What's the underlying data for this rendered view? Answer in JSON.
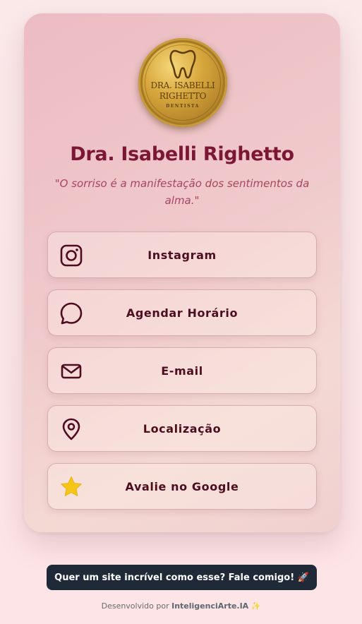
{
  "profile": {
    "logo_text_line1": "DRA. ISABELLI",
    "logo_text_line2": "RIGHETTO",
    "logo_text_line3": "DENTISTA",
    "name": "Dra. Isabelli Righetto",
    "quote": "\"O sorriso é a manifestação dos sentimentos da alma.\""
  },
  "links": [
    {
      "label": "Instagram",
      "icon": "instagram-icon"
    },
    {
      "label": "Agendar Horário",
      "icon": "whatsapp-chat-icon"
    },
    {
      "label": "E-mail",
      "icon": "mail-icon"
    },
    {
      "label": "Localização",
      "icon": "map-pin-icon"
    },
    {
      "label": "Avalie no Google",
      "icon": "star-icon"
    }
  ],
  "cta": {
    "label": "Quer um site incrível como esse? Fale comigo! 🚀"
  },
  "footer": {
    "prefix": "Desenvolvido por ",
    "brand": "InteligenciArte.IA",
    "suffix": " ✨"
  },
  "colors": {
    "title": "#7c1635",
    "quote": "#a8455c",
    "button_text": "#4d0d1f",
    "cta_bg": "#1f2937",
    "star": "#f5c518"
  }
}
